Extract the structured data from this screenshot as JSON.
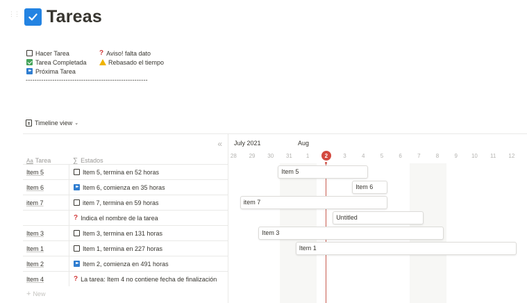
{
  "page": {
    "drag_handle": "⋮⋮",
    "title": "Tareas",
    "title_icon": "checkbox-icon"
  },
  "legend": {
    "items": [
      {
        "label": "Hacer Tarea",
        "icon": "empty-checkbox-icon"
      },
      {
        "label": "Aviso! falta dato",
        "icon": "question-icon"
      },
      {
        "label": "Tarea Completada",
        "icon": "check-mark-icon"
      },
      {
        "label": "Rebasado el tiempo",
        "icon": "warning-icon"
      },
      {
        "label": "Próxima Tarea",
        "icon": "next-track-icon"
      }
    ],
    "divider": "-------------------------------------------------------"
  },
  "view": {
    "label": "Timeline view",
    "chevron": "⌄"
  },
  "table": {
    "collapse": "«",
    "headers": {
      "name": "Tarea",
      "name_prefix": "Aa",
      "estado": "Estados",
      "estado_prefix": "∑"
    },
    "rows": [
      {
        "name": "Item 5",
        "estado": "Item 5, termina en 52 horas",
        "icon": "empty-checkbox-icon"
      },
      {
        "name": "Item 6",
        "estado": "Item 6, comienza en 35 horas",
        "icon": "next-track-icon"
      },
      {
        "name": "item 7",
        "estado": "item 7, termina en 59 horas",
        "icon": "empty-checkbox-icon"
      },
      {
        "name": "",
        "estado": "Indica el nombre de la tarea",
        "icon": "question-icon"
      },
      {
        "name": "Item 3",
        "estado": "Item 3, termina en 131 horas",
        "icon": "empty-checkbox-icon"
      },
      {
        "name": "Item 1",
        "estado": "Item 1, termina en 227 horas",
        "icon": "empty-checkbox-icon"
      },
      {
        "name": "Item 2",
        "estado": "Item 2, comienza en 491 horas",
        "icon": "next-track-icon"
      },
      {
        "name": "Item 4",
        "estado": "La tarea: Item 4 no contiene fecha de finalización",
        "icon": "question-icon"
      }
    ],
    "new_label": "New",
    "new_plus": "+"
  },
  "timeline": {
    "months": [
      "July 2021",
      "Aug"
    ],
    "days": [
      "28",
      "29",
      "30",
      "31",
      "1",
      "2",
      "3",
      "4",
      "5",
      "6",
      "7",
      "8",
      "9",
      "10",
      "11",
      "12",
      "13"
    ],
    "today": "2",
    "bars": [
      "Item 5",
      "Item 6",
      "item 7",
      "Untitled",
      "Item 3",
      "Item 1"
    ]
  },
  "colors": {
    "accent": "#2383e2",
    "today": "#d3493f",
    "done": "#44a35a",
    "next": "#2f7dd0",
    "question": "#d23a3a",
    "warning": "#f0b400"
  }
}
